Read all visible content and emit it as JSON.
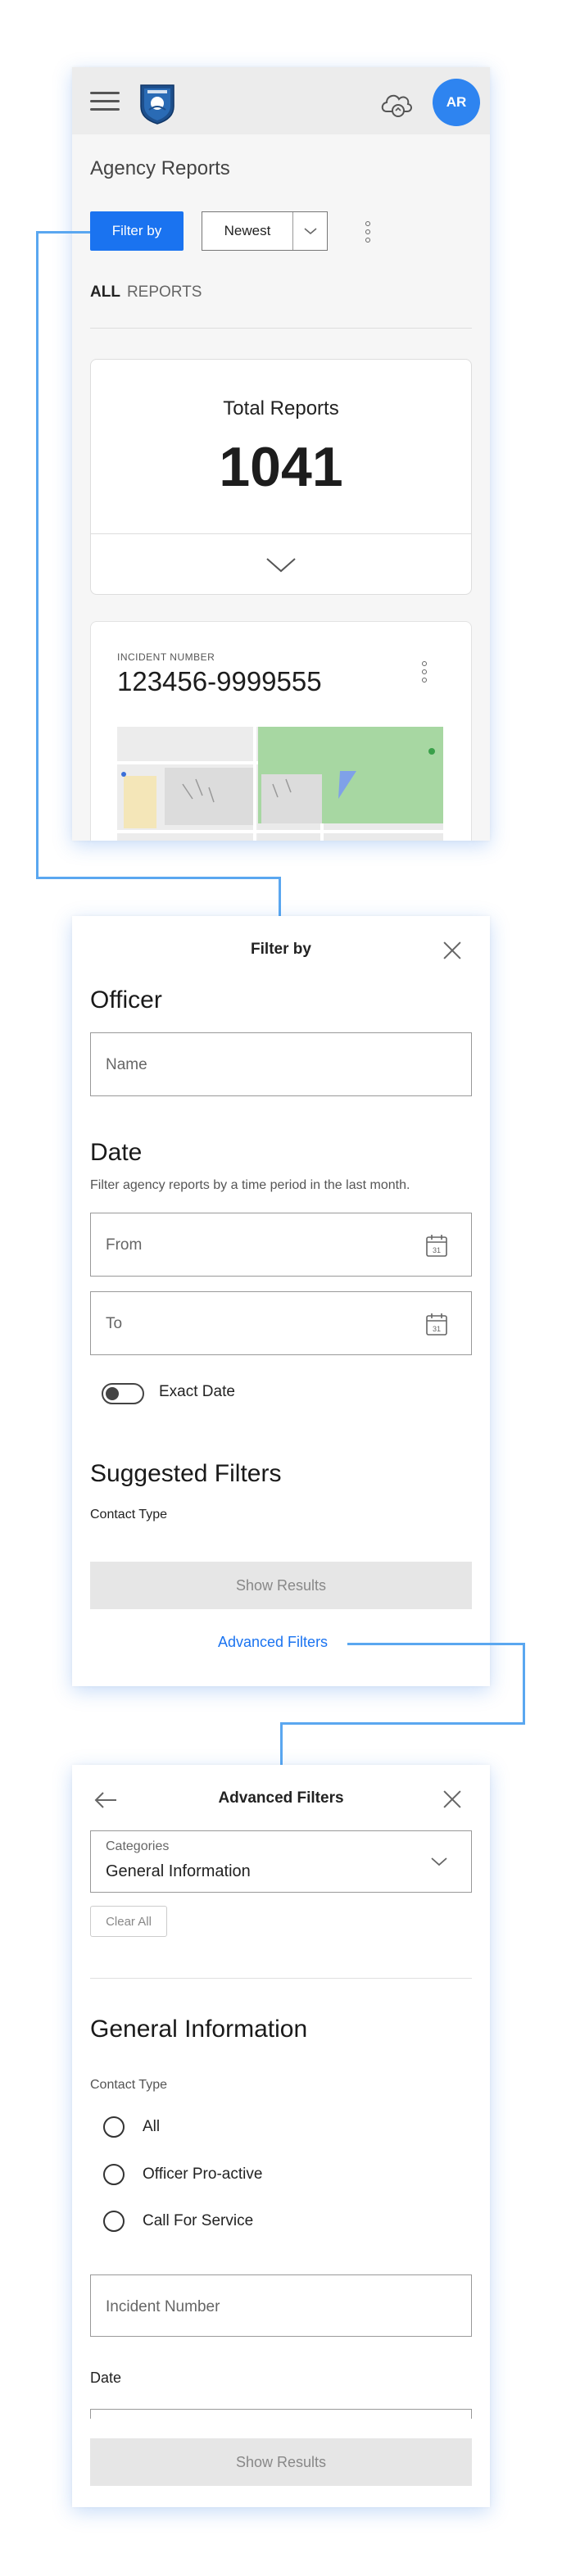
{
  "screen1": {
    "avatar_initials": "AR",
    "page_title": "Agency Reports",
    "filter_button": "Filter by",
    "sort_value": "Newest",
    "tab_all": "ALL",
    "tab_reports": "REPORTS",
    "total_label": "Total Reports",
    "total_value": "1041",
    "incident_label": "INCIDENT NUMBER",
    "incident_value": "123456-9999555",
    "icons": [
      "menu-icon",
      "agency-logo",
      "cloud-sync-icon",
      "chevron-down-icon",
      "more-vert-icon",
      "map-thumbnail"
    ]
  },
  "filter_panel": {
    "title": "Filter by",
    "officer_heading": "Officer",
    "name_placeholder": "Name",
    "date_heading": "Date",
    "date_subtitle": "Filter agency reports by a time period in the last month.",
    "from_placeholder": "From",
    "to_placeholder": "To",
    "exact_date_label": "Exact Date",
    "exact_date_on": false,
    "suggested_heading": "Suggested Filters",
    "contact_type_label": "Contact Type",
    "show_results": "Show Results",
    "advanced_link": "Advanced Filters"
  },
  "advanced_panel": {
    "title": "Advanced Filters",
    "categories_label": "Categories",
    "categories_value": "General Information",
    "clear_all": "Clear All",
    "section_heading": "General Information",
    "contact_type_label": "Contact Type",
    "contact_options": [
      "All",
      "Officer Pro-active",
      "Call For Service"
    ],
    "incident_placeholder": "Incident Number",
    "date_label": "Date",
    "show_results": "Show Results"
  },
  "colors": {
    "accent": "#1a73f0",
    "avatar": "#2e84f0",
    "connector": "#5aa7f0",
    "disabled_bg": "#e6e6e6"
  }
}
